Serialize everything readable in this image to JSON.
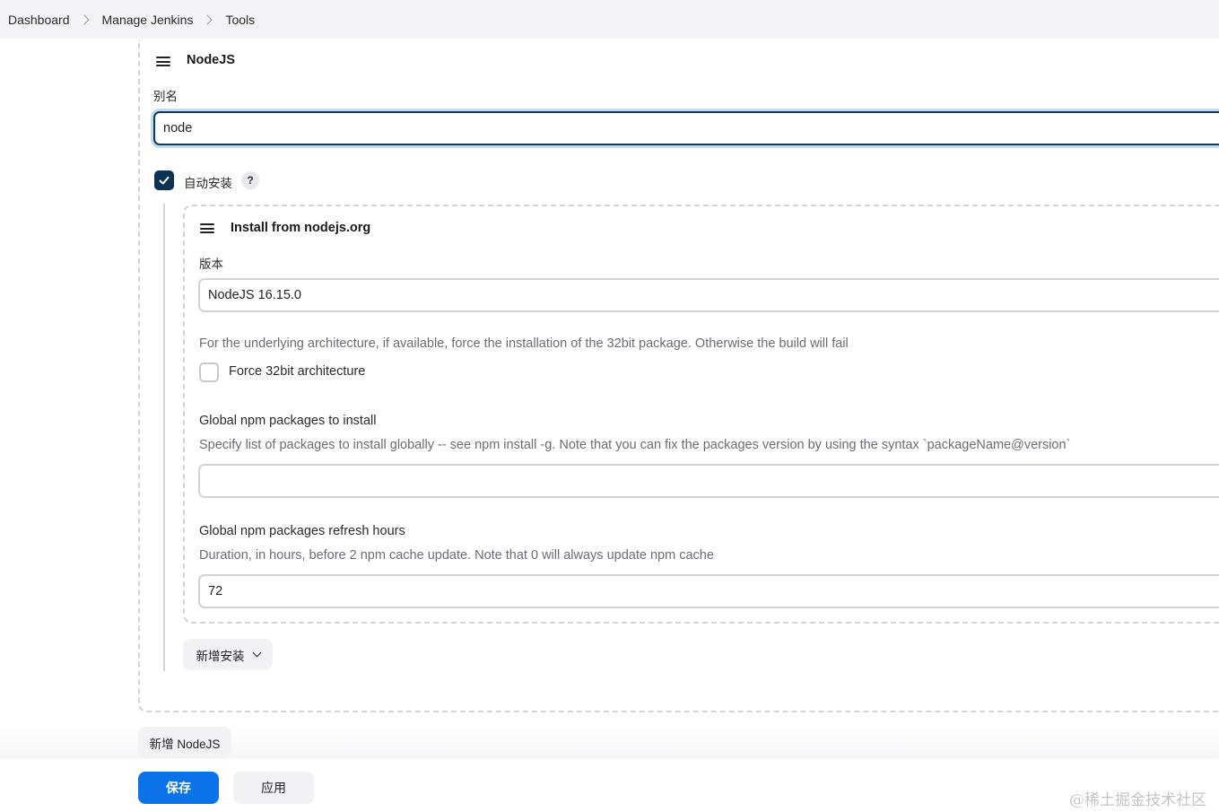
{
  "breadcrumb": {
    "items": [
      "Dashboard",
      "Manage Jenkins",
      "Tools"
    ]
  },
  "nodejs_section": {
    "title": "NodeJS",
    "alias_label": "别名",
    "alias_value": "node",
    "auto_install_label": "自动安装",
    "auto_install_checked": true,
    "help_symbol": "?"
  },
  "installer": {
    "title": "Install from nodejs.org",
    "version_label": "版本",
    "version_value": "NodeJS 16.15.0",
    "force32_description": "For the underlying architecture, if available, force the installation of the 32bit package. Otherwise the build will fail",
    "force32_label": "Force 32bit architecture",
    "force32_checked": false,
    "npm_packages_label": "Global npm packages to install",
    "npm_packages_description": "Specify list of packages to install globally -- see npm install -g. Note that you can fix the packages version by using the syntax `packageName@version`",
    "npm_packages_value": "",
    "refresh_label": "Global npm packages refresh hours",
    "refresh_description": "Duration, in hours, before 2 npm cache update. Note that 0 will always update npm cache",
    "refresh_value": "72"
  },
  "buttons": {
    "add_installer": "新增安装",
    "add_nodejs": "新增 NodeJS",
    "save": "保存",
    "apply": "应用"
  },
  "watermark": "@稀土掘金技术社区",
  "colors": {
    "primary": "#0b72e7",
    "checkbox": "#0d3354",
    "focus_border": "#0b3b5c"
  }
}
